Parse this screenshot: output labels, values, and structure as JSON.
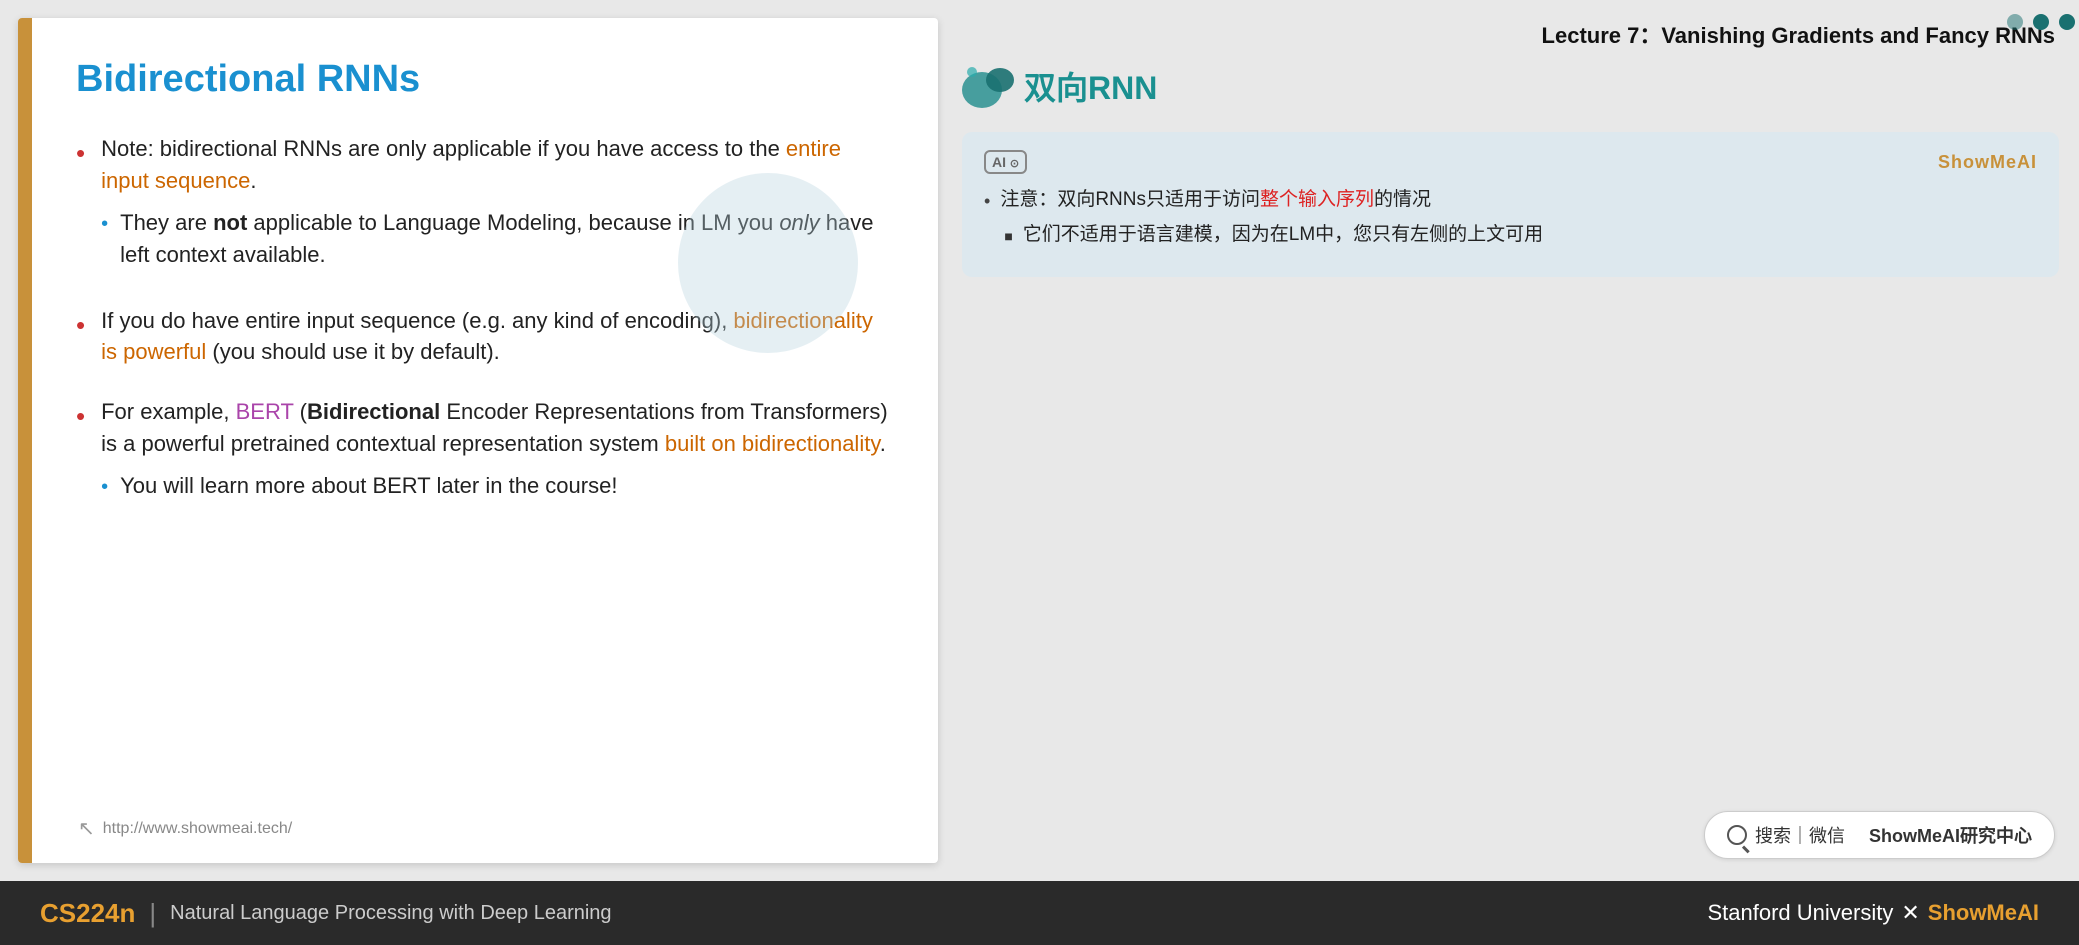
{
  "lecture_header": "Lecture 7：Vanishing Gradients and Fancy RNNs",
  "slide": {
    "title": "Bidirectional RNNs",
    "bullets": [
      {
        "id": "b1",
        "text_parts": [
          {
            "text": "Note: bidirectional RNNs are only applicable if you have access to the ",
            "style": "normal"
          },
          {
            "text": "entire input sequence",
            "style": "orange"
          },
          {
            "text": ".",
            "style": "normal"
          }
        ],
        "sub_bullets": [
          {
            "text_parts": [
              {
                "text": "They are ",
                "style": "normal"
              },
              {
                "text": "not",
                "style": "bold"
              },
              {
                "text": " applicable to Language Modeling, because in LM you ",
                "style": "normal"
              },
              {
                "text": "only",
                "style": "italic"
              },
              {
                "text": " have left context available.",
                "style": "normal"
              }
            ]
          }
        ]
      },
      {
        "id": "b2",
        "text_parts": [
          {
            "text": "If you do have entire input sequence (e.g. any kind of encoding), ",
            "style": "normal"
          },
          {
            "text": "bidirectionality is powerful",
            "style": "orange"
          },
          {
            "text": " (you should use it by default).",
            "style": "normal"
          }
        ],
        "sub_bullets": []
      },
      {
        "id": "b3",
        "text_parts": [
          {
            "text": "For example, ",
            "style": "normal"
          },
          {
            "text": "BERT",
            "style": "purple"
          },
          {
            "text": " (",
            "style": "normal"
          },
          {
            "text": "Bidirectional",
            "style": "bold"
          },
          {
            "text": " Encoder Representations from Transformers) is a powerful pretrained contextual representation system ",
            "style": "normal"
          },
          {
            "text": "built on bidirectionality",
            "style": "orange"
          },
          {
            "text": ".",
            "style": "normal"
          }
        ],
        "sub_bullets": [
          {
            "text_parts": [
              {
                "text": "You will learn more about BERT later in the course!",
                "style": "normal"
              }
            ]
          }
        ]
      }
    ],
    "footer_url": "http://www.showmeai.tech/"
  },
  "annotation_card": {
    "badge": "AI",
    "brand": "ShowMeAI",
    "title_chinese": "双向RNN",
    "bullets": [
      {
        "text_parts": [
          {
            "text": "注意：双向RNNs只适用于访问",
            "style": "normal"
          },
          {
            "text": "整个输入序列",
            "style": "red"
          },
          {
            "text": "的情况",
            "style": "normal"
          }
        ],
        "sub_bullets": [
          {
            "text_parts": [
              {
                "text": "它们不适用于语言建模，因为在LM中，您只有左侧的上文可用",
                "style": "normal"
              }
            ]
          }
        ]
      }
    ]
  },
  "nav_dots": [
    "filled",
    "filled",
    "filled"
  ],
  "search_bar": {
    "icon": "search",
    "text": "搜索｜微信",
    "brand": "ShowMeAI研究中心"
  },
  "bottom_bar": {
    "course_code": "CS224n",
    "divider": "|",
    "subtitle": "Natural Language Processing with Deep Learning",
    "right_text": "Stanford University",
    "x_mark": "✕",
    "right_brand": "ShowMeAI"
  }
}
